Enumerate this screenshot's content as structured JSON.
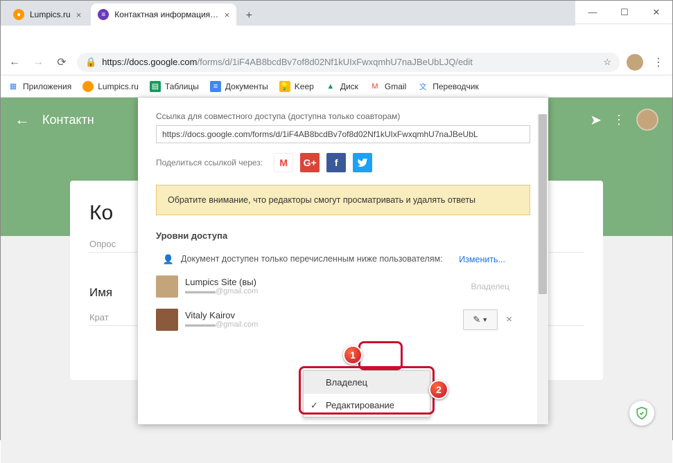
{
  "window": {
    "tabs": [
      {
        "label": "Lumpics.ru",
        "favicon_bg": "#ff9800"
      },
      {
        "label": "Контактная информация - Goo...",
        "favicon_bg": "#673ab7"
      }
    ]
  },
  "toolbar": {
    "url_host": "https://docs.google.com",
    "url_path": "/forms/d/1iF4AB8bcdBv7of8d02Nf1kUIxFwxqmhU7naJBeUbLJQ/edit"
  },
  "bookmarks": [
    {
      "label": "Приложения",
      "color": "#4285f4"
    },
    {
      "label": "Lumpics.ru",
      "color": "#ff9800"
    },
    {
      "label": "Таблицы",
      "color": "#0f9d58"
    },
    {
      "label": "Документы",
      "color": "#4285f4"
    },
    {
      "label": "Keep",
      "color": "#fbbc04"
    },
    {
      "label": "Диск",
      "color": "#0f9d58"
    },
    {
      "label": "Gmail",
      "color": "#ea4335"
    },
    {
      "label": "Переводчик",
      "color": "#4285f4"
    }
  ],
  "forms_header": {
    "title": "Контактн"
  },
  "form_card": {
    "title_partial": "Ко",
    "desc_placeholder": "Опрос",
    "field1_label": "Имя",
    "field1_placeholder": "Крат"
  },
  "share": {
    "link_label": "Ссылка для совместного доступа (доступна только соавторам)",
    "link_value": "https://docs.google.com/forms/d/1iF4AB8bcdBv7of8d02Nf1kUIxFwxqmhU7naJBeUbL",
    "share_via_label": "Поделиться ссылкой через:",
    "warning": "Обратите внимание, что редакторы смогут просматривать и удалять ответы",
    "access_section": "Уровни доступа",
    "access_desc": "Документ доступен только перечисленным ниже пользователям:",
    "change_link": "Изменить...",
    "users": [
      {
        "name": "Lumpics Site (вы)",
        "email": "@gmail.com",
        "role": "Владелец"
      },
      {
        "name": "Vitaly Kairov",
        "email": "@gmail.com",
        "role": ""
      }
    ],
    "role_menu": {
      "owner": "Владелец",
      "editor": "Редактирование"
    }
  },
  "badges": {
    "b1": "1",
    "b2": "2"
  }
}
